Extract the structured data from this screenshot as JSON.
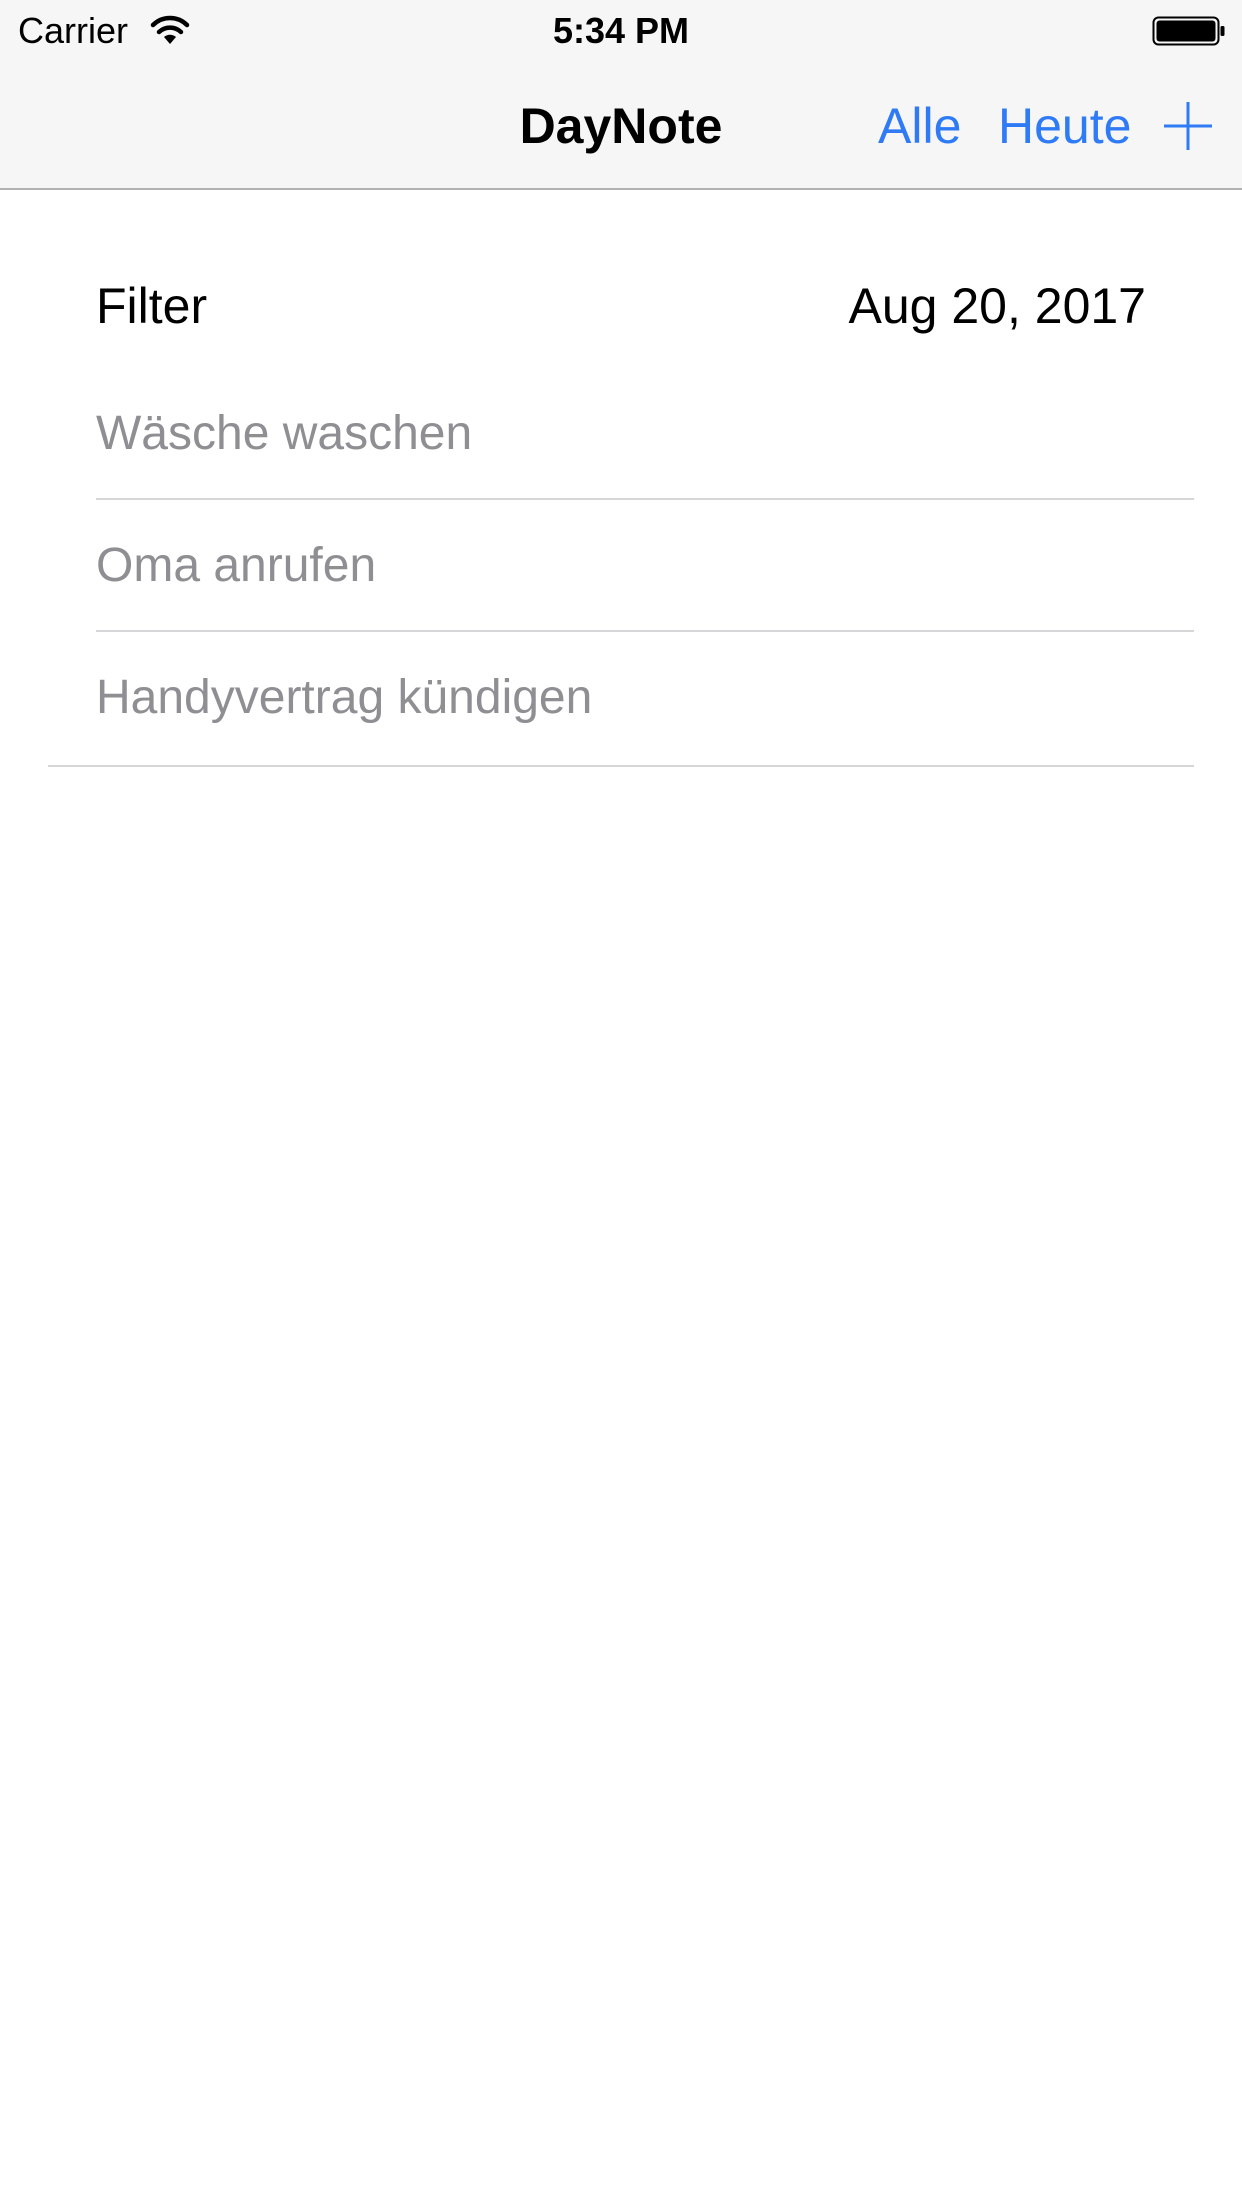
{
  "status_bar": {
    "carrier": "Carrier",
    "time": "5:34 PM",
    "icons": [
      "wifi-icon",
      "battery-icon"
    ]
  },
  "nav": {
    "title": "DayNote",
    "all_label": "Alle",
    "today_label": "Heute",
    "add_icon": "plus-icon"
  },
  "filter": {
    "label": "Filter",
    "date": "Aug 20, 2017"
  },
  "notes": [
    {
      "text": "Wäsche waschen"
    },
    {
      "text": "Oma anrufen"
    },
    {
      "text": "Handyvertrag kündigen"
    }
  ],
  "colors": {
    "accent": "#2f7bf5",
    "bar_background": "#f6f6f6",
    "note_text": "#8e8e93",
    "separator": "#d6d6d8"
  }
}
